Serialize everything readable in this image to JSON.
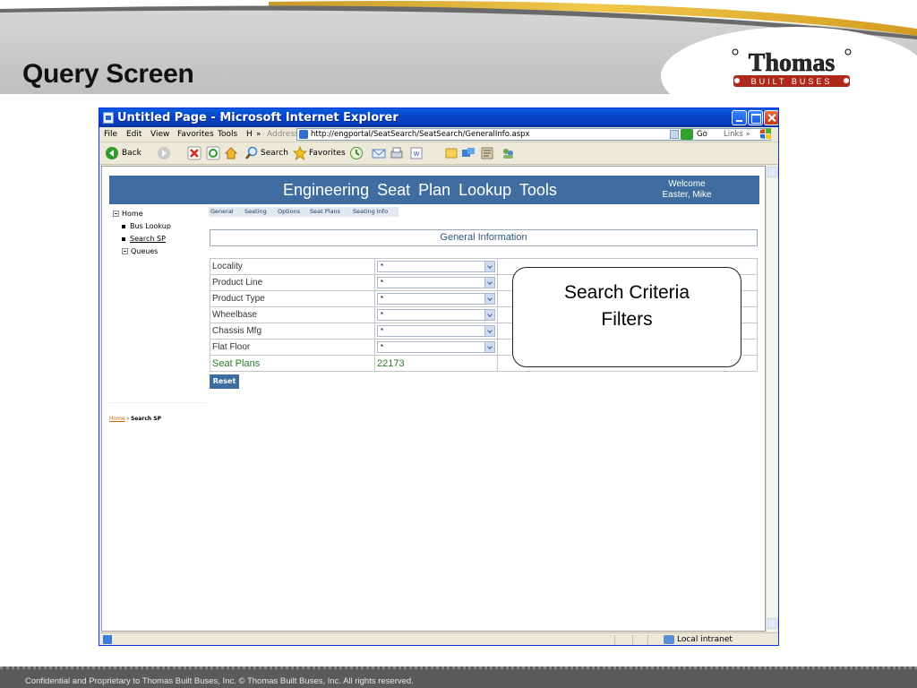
{
  "slide": {
    "title": "Query Screen",
    "logo": {
      "brand": "Thomas",
      "tagline": "BUILT BUSES"
    },
    "footer": "Confidential and Proprietary to Thomas Built Buses, Inc.  © Thomas Built Buses, Inc.  All rights reserved."
  },
  "browser": {
    "title": "Untitled Page - Microsoft Internet Explorer",
    "menu": [
      "File",
      "Edit",
      "View",
      "Favorites",
      "Tools",
      "H"
    ],
    "menu_more": "»",
    "address_label": "Address",
    "address_url": "http://engportal/SeatSearch/SeatSearch/GeneralInfo.aspx",
    "go_label": "Go",
    "links_label": "Links »",
    "toolbar": {
      "back": "Back",
      "search": "Search",
      "favorites": "Favorites"
    },
    "status_zone": "Local intranet"
  },
  "page": {
    "app_title": "Engineering  Seat  Plan  Lookup  Tools",
    "welcome": "Welcome",
    "user": "Easter, Mike",
    "tree": {
      "home": "Home",
      "items": [
        "Bus Lookup",
        "Search SP"
      ],
      "queues": "Queues"
    },
    "tabs": [
      "General",
      "Seating",
      "Options",
      "Seat Plans",
      "Seating Info"
    ],
    "section_title": "General Information",
    "filters": [
      {
        "label": "Locality",
        "value": "*"
      },
      {
        "label": "Product Line",
        "value": "*"
      },
      {
        "label": "Product Type",
        "value": "*"
      },
      {
        "label": "Wheelbase",
        "value": "*"
      },
      {
        "label": "Chassis Mfg",
        "value": "*"
      },
      {
        "label": "Flat Floor",
        "value": "*"
      }
    ],
    "seat_plans": {
      "label": "Seat Plans",
      "value": "22173"
    },
    "reset_label": "Reset",
    "breadcrumb": {
      "home": "Home",
      "separator": "›",
      "current": "Search SP"
    }
  },
  "callout": {
    "line1": "Search Criteria",
    "line2": "Filters"
  },
  "colors": {
    "header_blue": "#3f6d9f",
    "xp_title": "#0845c8",
    "seat_plans_green": "#2a7a2a",
    "footer_gray": "#5b5b5b"
  }
}
